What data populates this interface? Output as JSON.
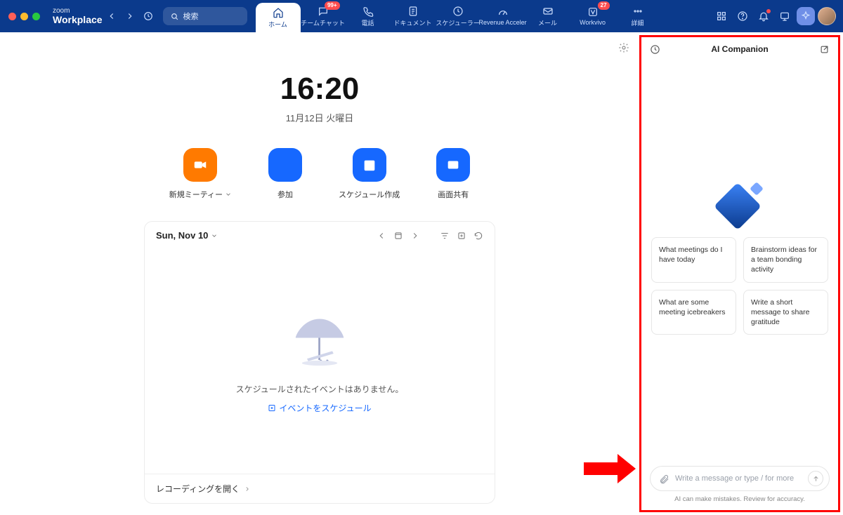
{
  "brand": {
    "small": "zoom",
    "big": "Workplace"
  },
  "search": {
    "placeholder": "検索"
  },
  "tabs": [
    {
      "label": "ホーム",
      "icon": "home",
      "active": true
    },
    {
      "label": "チームチャット",
      "icon": "chat",
      "badge": "99+"
    },
    {
      "label": "電話",
      "icon": "phone"
    },
    {
      "label": "ドキュメント",
      "icon": "doc"
    },
    {
      "label": "スケジューラー",
      "icon": "clock"
    },
    {
      "label": "Revenue Acceler",
      "icon": "gauge"
    },
    {
      "label": "メール",
      "icon": "mail"
    },
    {
      "label": "Workvivo",
      "icon": "workvivo",
      "badge": "27"
    },
    {
      "label": "詳細",
      "icon": "more"
    }
  ],
  "clock": {
    "time": "16:20",
    "date": "11月12日 火曜日"
  },
  "actions": [
    {
      "label": "新規ミーティー",
      "icon": "video",
      "color": "orange",
      "chevron": true
    },
    {
      "label": "参加",
      "icon": "plus",
      "color": "blue"
    },
    {
      "label": "スケジュール作成",
      "icon": "cal19",
      "color": "blue"
    },
    {
      "label": "画面共有",
      "icon": "share",
      "color": "blue"
    }
  ],
  "card": {
    "date": "Sun, Nov 10",
    "empty_msg": "スケジュールされたイベントはありません。",
    "schedule_link": "イベントをスケジュール",
    "footer": "レコーディングを開く"
  },
  "panel": {
    "title": "AI Companion",
    "suggestions": [
      "What meetings do I have today",
      "Brainstorm ideas for a team bonding activity",
      "What are some meeting icebreakers",
      "Write a short message to share gratitude"
    ],
    "placeholder": "Write a message or type / for more",
    "disclaimer": "AI can make mistakes. Review for accuracy."
  }
}
